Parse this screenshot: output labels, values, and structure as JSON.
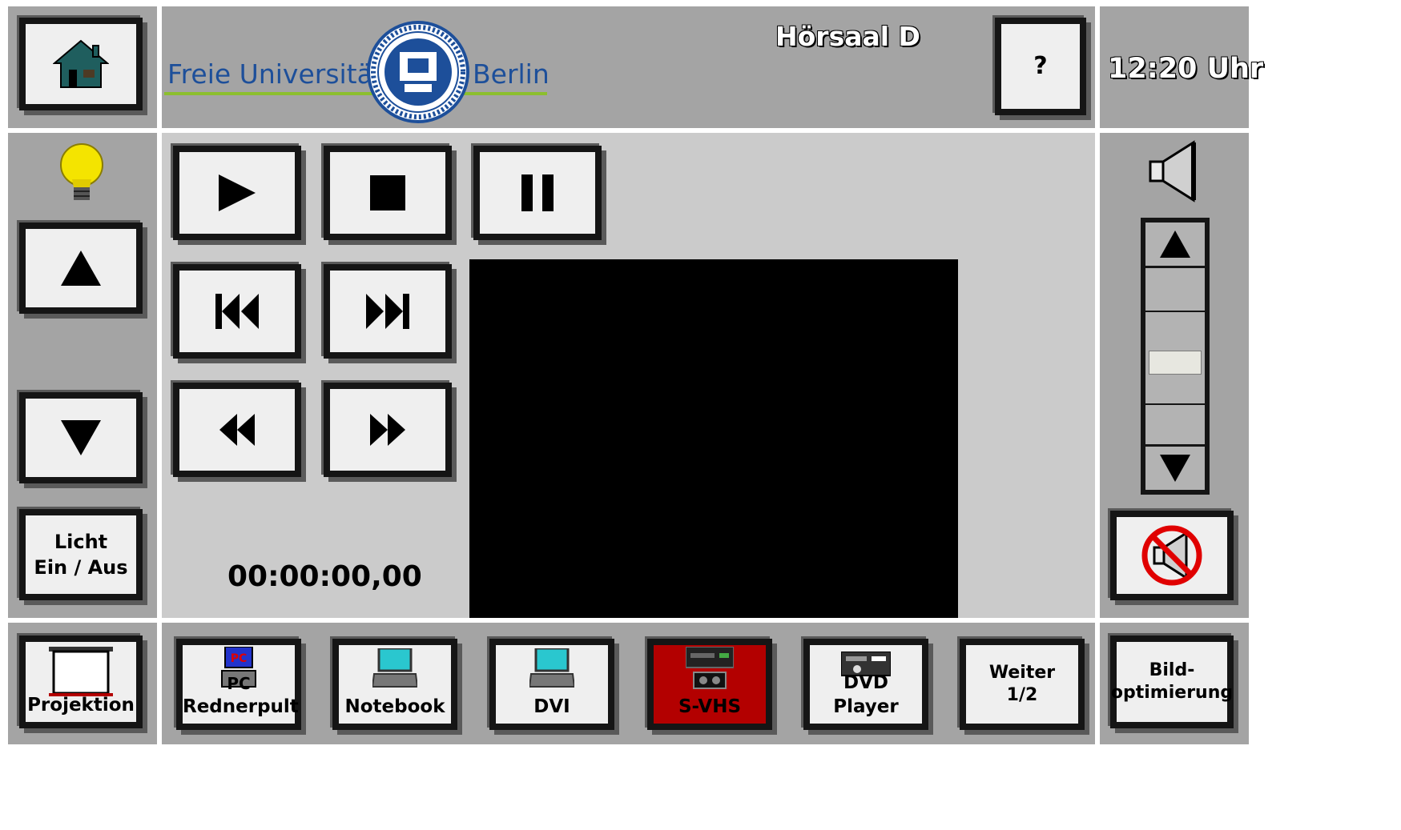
{
  "header": {
    "logo_left": "Freie Universität",
    "logo_right": "Berlin",
    "seal_text": "VERITAS IUSTITIA LIBERTAS",
    "room": "Hörsaal D",
    "help_label": "?",
    "clock": "12:20 Uhr"
  },
  "left": {
    "light_label_1": "Licht",
    "light_label_2": "Ein / Aus"
  },
  "transport": {
    "timecode": "00:00:00,00"
  },
  "volume": {
    "level_fraction": 0.55
  },
  "sources": [
    {
      "label": "Projektion"
    },
    {
      "label": "Rednerpult",
      "badge": "PC"
    },
    {
      "label": "Notebook"
    },
    {
      "label": "DVI"
    },
    {
      "label": "S-VHS"
    },
    {
      "label": "DVD Player"
    },
    {
      "label": "Weiter",
      "label2": "1/2"
    },
    {
      "label": "Bild-",
      "label2": "optimierung"
    }
  ],
  "colors": {
    "panel": "#a4a4a4",
    "active_source": "#b30000",
    "fu_blue": "#1d4f9a",
    "fu_green": "#8cbf2e"
  }
}
